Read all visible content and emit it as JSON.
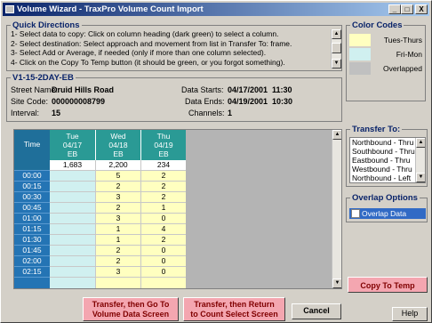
{
  "window": {
    "title": "Volume Wizard - TraxPro Volume Count Import",
    "minimize": "_",
    "maximize": "□",
    "close": "X"
  },
  "quick_directions": {
    "heading": "Quick Directions",
    "lines": [
      "1- Select data to copy: Click on column heading (dark green) to select a column.",
      "2- Select destination: Select approach and movement from list in Transfer To: frame.",
      "3- Select Add or Average, if needed (only if more than one column selected).",
      "4- Click on the Copy To Temp button (it should be green, or you forgot something)."
    ]
  },
  "color_codes": {
    "heading": "Color Codes",
    "items": [
      {
        "label": "Tues-Thurs",
        "color": "#ffffc0"
      },
      {
        "label": "Fri-Mon",
        "color": "#d0f0f0"
      },
      {
        "label": "Overlapped",
        "color": "#c0c0c0"
      }
    ]
  },
  "count_info": {
    "heading": "V1-15-2DAY-EB",
    "street_name_label": "Street Name:",
    "street_name": "Druid Hills Road",
    "site_code_label": "Site Code:",
    "site_code": "000000008799",
    "interval_label": "Interval:",
    "interval": "15",
    "data_starts_label": "Data Starts:",
    "data_starts": "04/17/2001  11:30",
    "data_ends_label": "Data Ends:",
    "data_ends": "04/19/2001  10:30",
    "channels_label": "Channels:",
    "channels": "1"
  },
  "grid": {
    "time_header": "Time",
    "columns": [
      {
        "day": "Tue",
        "date": "04/17",
        "dir": "EB",
        "total": "1,683",
        "color": "#d0f0f0"
      },
      {
        "day": "Wed",
        "date": "04/18",
        "dir": "EB",
        "total": "2,200",
        "color": "#ffffc0"
      },
      {
        "day": "Thu",
        "date": "04/19",
        "dir": "EB",
        "total": "234",
        "color": "#ffffc0"
      }
    ],
    "rows": [
      {
        "time": "00:00",
        "values": [
          "",
          "5",
          "2"
        ]
      },
      {
        "time": "00:15",
        "values": [
          "",
          "2",
          "2"
        ]
      },
      {
        "time": "00:30",
        "values": [
          "",
          "3",
          "2"
        ]
      },
      {
        "time": "00:45",
        "values": [
          "",
          "2",
          "1"
        ]
      },
      {
        "time": "01:00",
        "values": [
          "",
          "3",
          "0"
        ]
      },
      {
        "time": "01:15",
        "values": [
          "",
          "1",
          "4"
        ]
      },
      {
        "time": "01:30",
        "values": [
          "",
          "1",
          "2"
        ]
      },
      {
        "time": "01:45",
        "values": [
          "",
          "2",
          "0"
        ]
      },
      {
        "time": "02:00",
        "values": [
          "",
          "2",
          "0"
        ]
      },
      {
        "time": "02:15",
        "values": [
          "",
          "3",
          "0"
        ]
      }
    ]
  },
  "transfer_to": {
    "heading": "Transfer To:",
    "items": [
      "Northbound - Thru",
      "Southbound - Thru",
      "Eastbound - Thru",
      "Westbound - Thru",
      "Northbound - Left"
    ]
  },
  "overlap_options": {
    "heading": "Overlap Options",
    "checkbox_label": "Overlap Data"
  },
  "buttons": {
    "copy_to_temp": "Copy To Temp",
    "transfer_go_line1": "Transfer, then Go To",
    "transfer_go_line2": "Volume Data Screen",
    "transfer_return_line1": "Transfer, then Return",
    "transfer_return_line2": "to Count Select Screen",
    "cancel": "Cancel",
    "help": "Help"
  }
}
